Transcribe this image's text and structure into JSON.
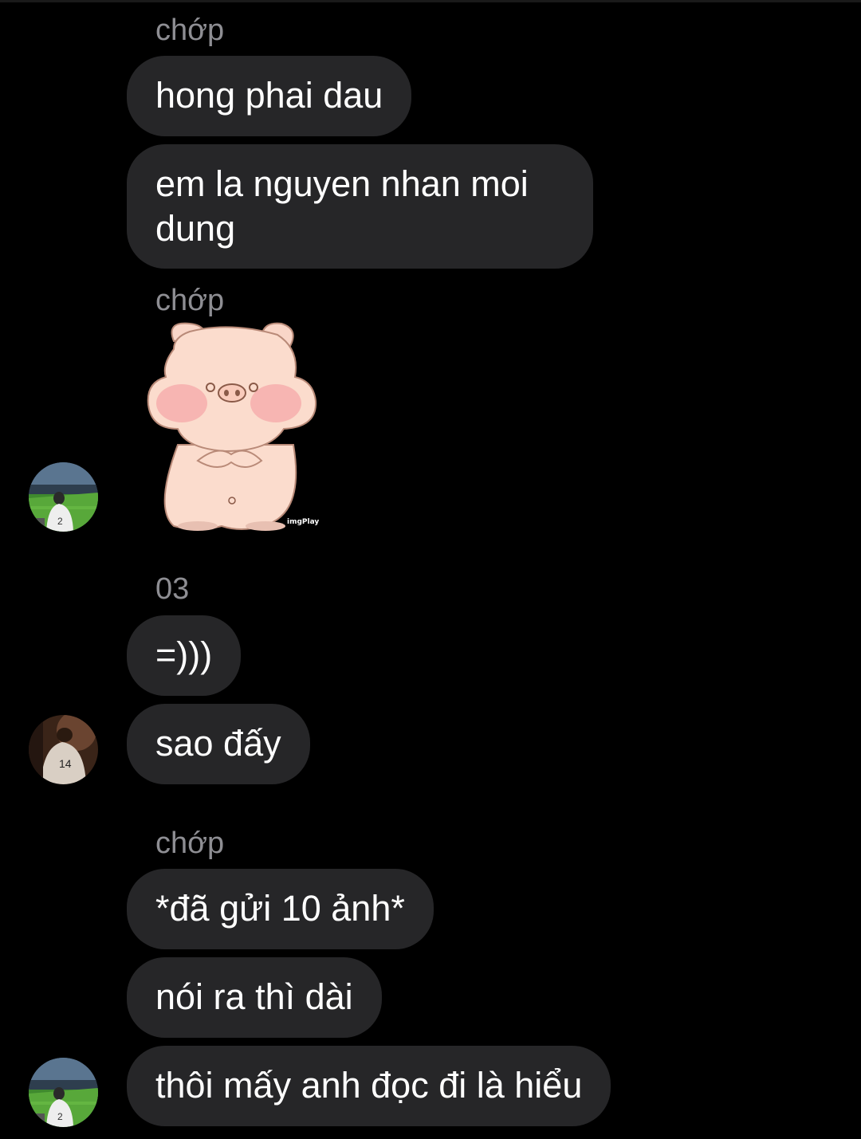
{
  "messages": {
    "sender_1": "chớp",
    "msg_1": "hong phai dau",
    "msg_2": "em la nguyen nhan moi dung",
    "sender_2": "chớp",
    "sticker_watermark": "imgPlay",
    "sender_3": "03",
    "msg_3": "=)))",
    "msg_4": "sao đấy",
    "sender_4": "chớp",
    "msg_5": "*đã gửi 10 ảnh*",
    "msg_6": "nói ra thì dài",
    "msg_7": "thôi mấy anh đọc đi là hiểu"
  },
  "icons": {
    "avatar_a": "stadium-photo-avatar",
    "avatar_b": "jersey-photo-avatar",
    "sticker": "pig-sticker"
  },
  "colors": {
    "background": "#000000",
    "bubble": "#262628",
    "sender_text": "#8e8e93",
    "message_text": "#ffffff"
  }
}
